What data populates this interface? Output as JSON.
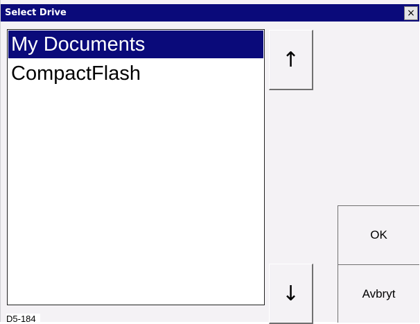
{
  "window": {
    "title": "Select Drive",
    "close_symbol": "×",
    "title_bar_color": "#0a0a7a"
  },
  "drive_list": {
    "items": [
      {
        "label": "My Documents",
        "selected": true
      },
      {
        "label": "CompactFlash",
        "selected": false
      }
    ]
  },
  "buttons": {
    "up_arrow": "↑",
    "down_arrow": "↓",
    "ok": "OK",
    "cancel": "Avbryt"
  },
  "caption": "D5-184"
}
